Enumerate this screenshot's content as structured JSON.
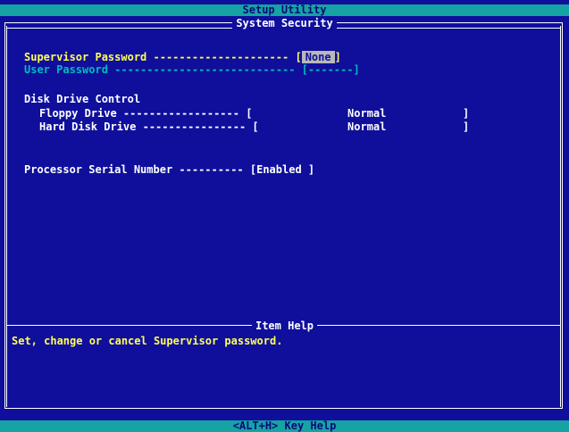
{
  "header": {
    "title": "Setup Utility",
    "section": "System Security"
  },
  "security": {
    "supervisor_label": "Supervisor Password",
    "supervisor_dashes": " --------------------- ",
    "supervisor_value": "None",
    "user_label": "User Password",
    "user_dashes": " ---------------------------- ",
    "user_value": "-------"
  },
  "disk": {
    "heading": "Disk Drive Control",
    "floppy_label": "Floppy Drive",
    "floppy_dashes": " ------------------ ",
    "floppy_value": "Normal",
    "hdd_label": "Hard Disk Drive",
    "hdd_dashes": " ---------------- ",
    "hdd_value": "Normal"
  },
  "processor": {
    "label": "Processor Serial Number",
    "dashes": " ---------- ",
    "value": "Enabled"
  },
  "help": {
    "title": "Item Help",
    "text": "Set, change or cancel Supervisor password."
  },
  "footer": {
    "hint": "<ALT+H>  Key Help"
  }
}
